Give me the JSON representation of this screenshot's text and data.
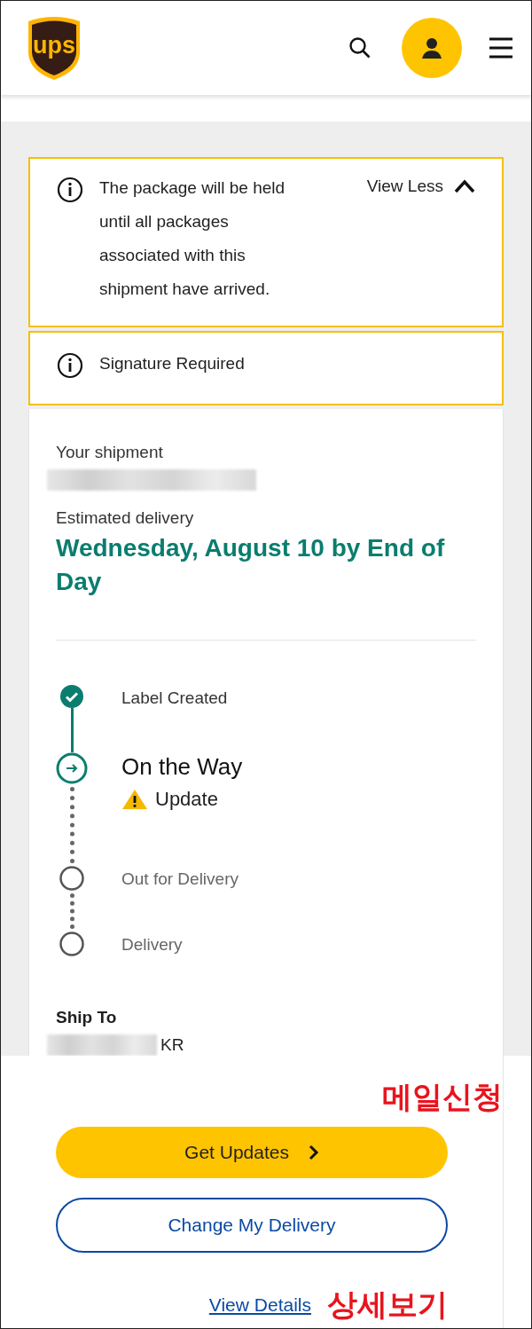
{
  "header": {
    "logo_text": "ups"
  },
  "alerts": [
    {
      "text": "The package will be held until all packages associated with this shipment have arrived.",
      "toggle": "View Less",
      "expanded": true
    },
    {
      "text": "Signature Required"
    }
  ],
  "shipment": {
    "label": "Your shipment",
    "estimate_label": "Estimated delivery",
    "estimate": "Wednesday, August 10 by End of Day"
  },
  "progress": [
    {
      "label": "Label Created",
      "kind": "done"
    },
    {
      "label": "On the Way",
      "kind": "current",
      "note": "Update"
    },
    {
      "label": "Out for Delivery",
      "kind": "pending"
    },
    {
      "label": "Delivery",
      "kind": "pending"
    }
  ],
  "ship_to": {
    "label": "Ship To",
    "country": "KR"
  },
  "actions": {
    "primary": "Get Updates",
    "secondary": "Change My Delivery",
    "link": "View Details"
  },
  "annotations": [
    "메일신청",
    "상세보기"
  ]
}
